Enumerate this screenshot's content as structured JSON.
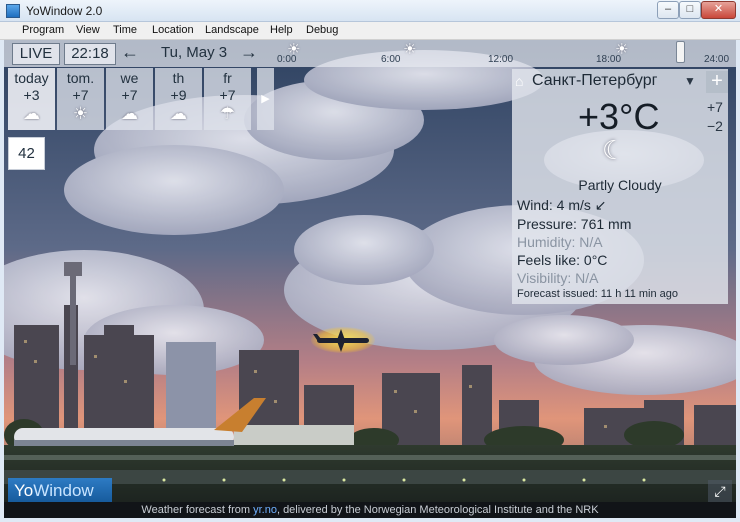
{
  "window": {
    "title": "YoWindow 2.0",
    "controls": {
      "minimize": "–",
      "maximize": "□",
      "close": "✕"
    }
  },
  "menu": [
    "Program",
    "View",
    "Time",
    "Location",
    "Landscape",
    "Help",
    "Debug"
  ],
  "topbar": {
    "live": "LIVE",
    "time": "22:18",
    "prev": "←",
    "date": "Tu, May 3",
    "next": "→",
    "timeline_labels": [
      "0:00",
      "6:00",
      "12:00",
      "18:00",
      "24:00"
    ],
    "timeline_icons": [
      "sun-cloud-icon",
      "sun-icon",
      "sun-cloud-icon"
    ]
  },
  "days": [
    {
      "name": "today",
      "temp": "+3",
      "icon": "cloud-icon"
    },
    {
      "name": "tom.",
      "temp": "+7",
      "icon": "sun-icon"
    },
    {
      "name": "we",
      "temp": "+7",
      "icon": "cloud-icon"
    },
    {
      "name": "th",
      "temp": "+9",
      "icon": "cloud-icon"
    },
    {
      "name": "fr",
      "temp": "+7",
      "icon": "rain-cloud-icon"
    }
  ],
  "days_next": "▶",
  "side_number": "42",
  "panel": {
    "city": "Санкт-Петербург",
    "dropdown": "▼",
    "add": "+",
    "temp": "+3°C",
    "high": "+7",
    "low": "−2",
    "condition": "Partly Cloudy",
    "wind": "Wind:  4 m/s  ↙",
    "pressure": "Pressure:  761 mm",
    "humidity": "Humidity:  N/A",
    "feels": "Feels like:  0°C",
    "visibility": "Visibility:  N/A",
    "issued": "Forecast issued:  11 h 11 min ago"
  },
  "logo": {
    "yo": "Yo",
    "window": "Window"
  },
  "fullscreen": "⤢",
  "footer": {
    "prefix": "Weather forecast from",
    "link": "yr.no",
    "suffix": ", delivered by the Norwegian Meteorological Institute and the NRK"
  },
  "colors": {
    "sky_top": "#3a4f6e",
    "sky_horizon": "#d98a6f",
    "panel_bg": "#e0e4ec",
    "logo_blue": "#1f6fbf"
  }
}
